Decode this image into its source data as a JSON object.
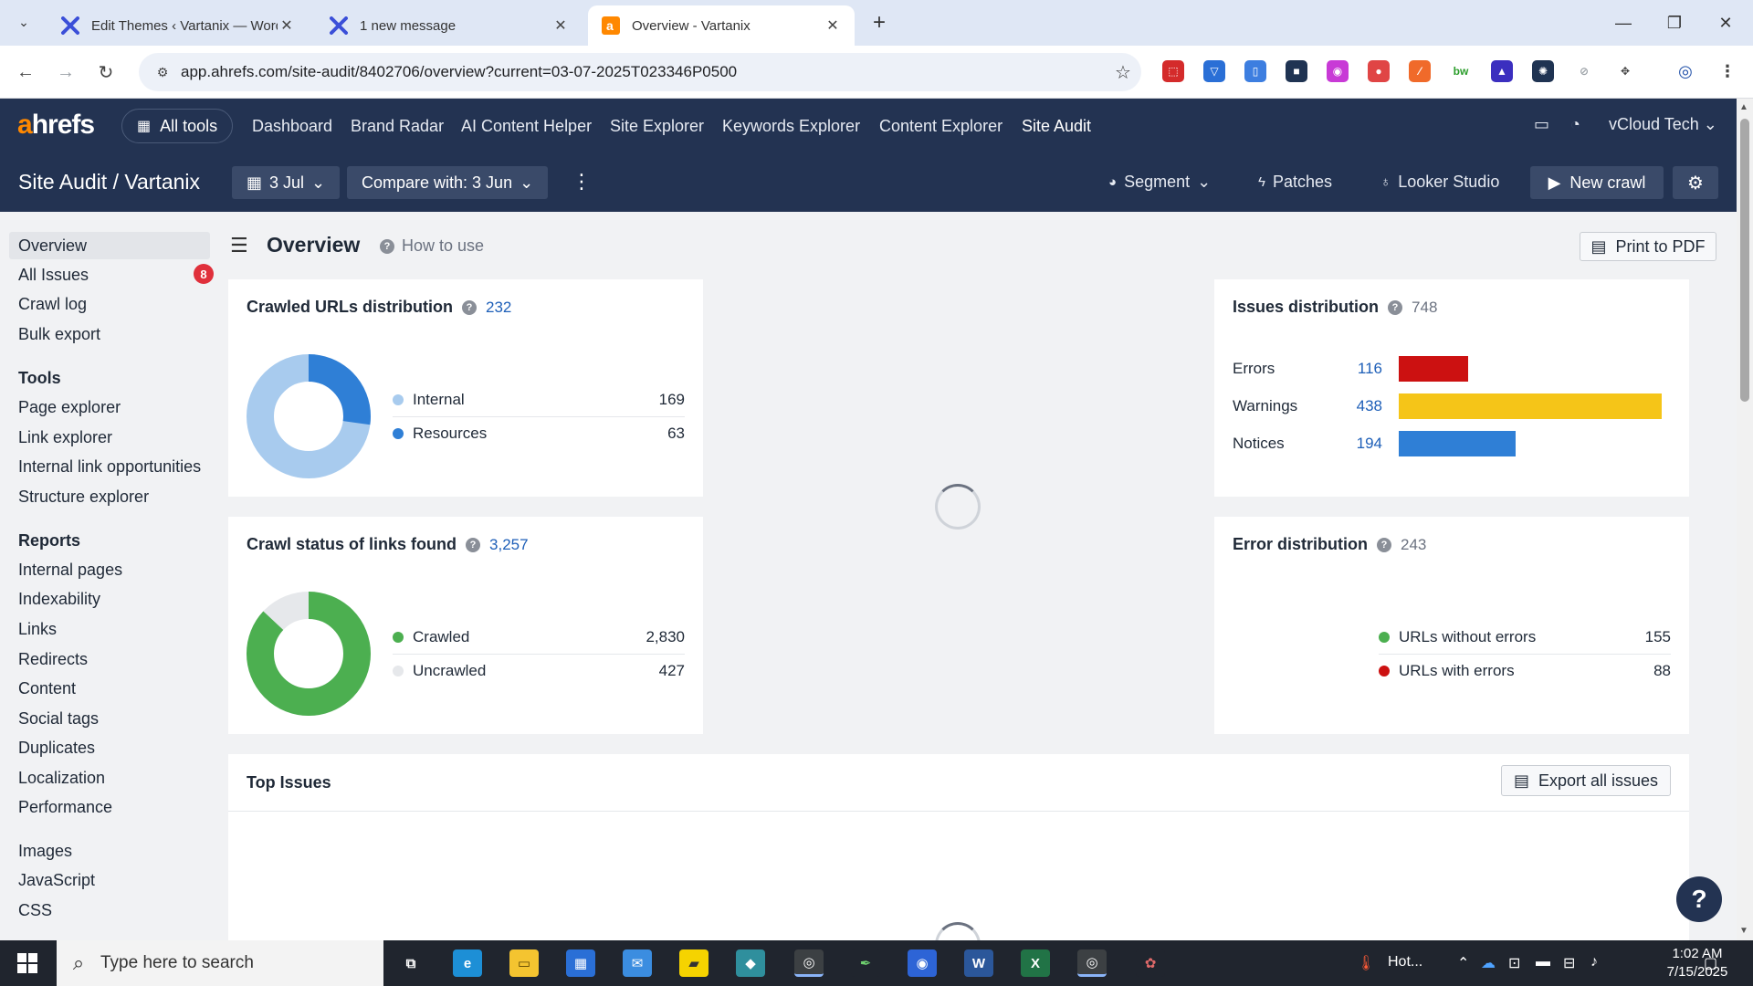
{
  "browser": {
    "tabs": [
      {
        "title": "Edit Themes ‹ Vartanix — WordPress",
        "active": false
      },
      {
        "title": "1 new message",
        "active": false
      },
      {
        "title": "Overview - Vartanix",
        "active": true
      }
    ],
    "url": "app.ahrefs.com/site-audit/8402706/overview?current=03-07-2025T023346P0500"
  },
  "topnav": {
    "logo_a": "a",
    "logo_rest": "hrefs",
    "all_tools": "All tools",
    "links": [
      "Dashboard",
      "Brand Radar",
      "AI Content Helper",
      "Site Explorer",
      "Keywords Explorer",
      "Content Explorer",
      "Site Audit"
    ],
    "account": "vCloud Tech"
  },
  "subbar": {
    "breadcrumb": "Site Audit  /  Vartanix",
    "date": "3 Jul",
    "compare": "Compare with: 3 Jun",
    "segment": "Segment",
    "patches": "Patches",
    "looker": "Looker Studio",
    "new_crawl": "New crawl"
  },
  "sidebar": {
    "top_items": [
      {
        "label": "Overview"
      },
      {
        "label": "All Issues",
        "badge": "8"
      },
      {
        "label": "Crawl log"
      },
      {
        "label": "Bulk export"
      }
    ],
    "tools_heading": "Tools",
    "tools": [
      "Page explorer",
      "Link explorer",
      "Internal link opportunities",
      "Structure explorer"
    ],
    "reports_heading": "Reports",
    "reports": [
      "Internal pages",
      "Indexability",
      "Links",
      "Redirects",
      "Content",
      "Social tags",
      "Duplicates",
      "Localization",
      "Performance"
    ],
    "other": [
      "Images",
      "JavaScript",
      "CSS"
    ]
  },
  "main": {
    "title": "Overview",
    "how_to_use": "How to use",
    "print": "Print to PDF",
    "export": "Export all issues",
    "top_issues": "Top Issues"
  },
  "cards": {
    "crawled": {
      "title": "Crawled URLs distribution",
      "total": "232",
      "rows": [
        {
          "label": "Internal",
          "value": "169",
          "color": "#a8cbee"
        },
        {
          "label": "Resources",
          "value": "63",
          "color": "#2f7fd6"
        }
      ]
    },
    "crawlstatus": {
      "title": "Crawl status of links found",
      "total": "3,257",
      "rows": [
        {
          "label": "Crawled",
          "value": "2,830",
          "color": "#4caf50"
        },
        {
          "label": "Uncrawled",
          "value": "427",
          "color": "#e6e8eb"
        }
      ]
    },
    "issues": {
      "title": "Issues distribution",
      "total": "748",
      "rows": [
        {
          "label": "Errors",
          "value": "116",
          "color": "#cc1111"
        },
        {
          "label": "Warnings",
          "value": "438",
          "color": "#f5c518"
        },
        {
          "label": "Notices",
          "value": "194",
          "color": "#2f7fd6"
        }
      ]
    },
    "errors": {
      "title": "Error distribution",
      "total": "243",
      "rows": [
        {
          "label": "URLs without errors",
          "value": "155",
          "color": "#4caf50"
        },
        {
          "label": "URLs with errors",
          "value": "88",
          "color": "#cc1111"
        }
      ]
    }
  },
  "taskbar": {
    "search_placeholder": "Type here to search",
    "weather": "Hot...",
    "time": "1:02 AM",
    "date": "7/15/2025"
  }
}
